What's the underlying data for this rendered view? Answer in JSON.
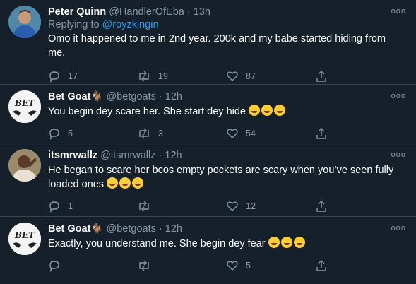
{
  "tweets": [
    {
      "name": "Peter Quinn",
      "badge": "",
      "handle": "@HandlerOfEba",
      "time": "13h",
      "reply_prefix": "Replying to",
      "reply_to": "@royzkingin",
      "text": "Omo it happened to me in 2nd year. 200k and my babe started hiding from me.",
      "emoji_count": 0,
      "reply_count": "17",
      "retweet_count": "19",
      "like_count": "87"
    },
    {
      "name": "Bet Goat",
      "badge": "🐐",
      "handle": "@betgoats",
      "time": "12h",
      "text": "You begin dey scare her. She start dey hide",
      "avatar_text": "BET",
      "emoji_count": 3,
      "reply_count": "5",
      "retweet_count": "3",
      "like_count": "54"
    },
    {
      "name": "itsmrwallz",
      "badge": "",
      "handle": "@itsmrwallz",
      "time": "12h",
      "text": "He began to scare her bcos empty pockets are scary when you’ve seen fully loaded ones",
      "emoji_count": 3,
      "reply_count": "1",
      "retweet_count": "",
      "like_count": "12"
    },
    {
      "name": "Bet Goat",
      "badge": "🐐",
      "handle": "@betgoats",
      "time": "12h",
      "text": "Exactly, you understand me. She begin dey fear",
      "avatar_text": "BET",
      "emoji_count": 3,
      "reply_count": "",
      "retweet_count": "",
      "like_count": "5"
    }
  ],
  "separator": "·",
  "more_label": "ooo",
  "colors": {
    "background": "#15202b",
    "secondary_text": "#8899a6",
    "link": "#1da1f2",
    "divider": "#38444d"
  }
}
